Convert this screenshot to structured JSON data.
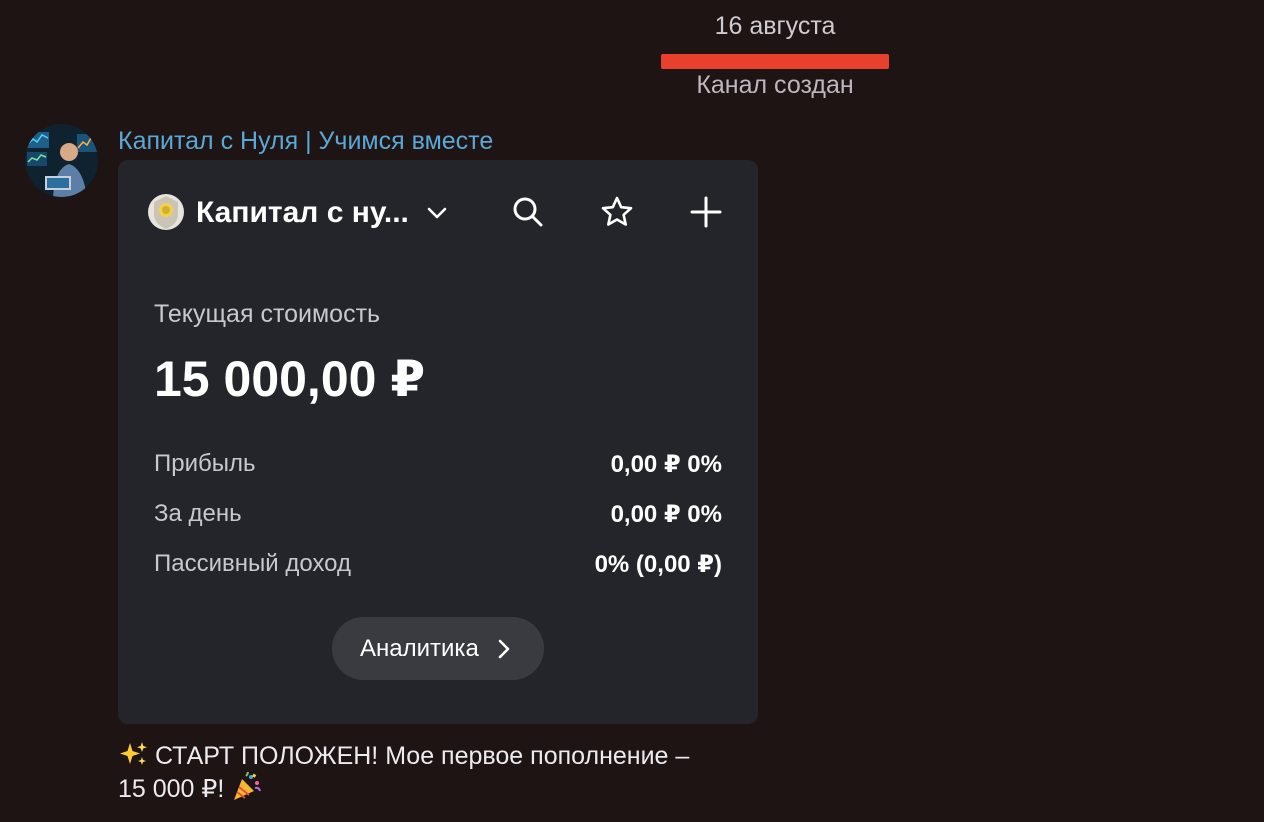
{
  "chat": {
    "date": "16 августа",
    "service_message": "Канал создан",
    "channel_name": "Капитал с Нуля | Учимся вместе"
  },
  "portfolio_card": {
    "portfolio_name": "Капитал с ну...",
    "current_value_label": "Текущая стоимость",
    "current_value": "15 000,00 ₽",
    "stats": [
      {
        "label": "Прибыль",
        "value": "0,00 ₽  0%"
      },
      {
        "label": "За день",
        "value": "0,00 ₽  0%"
      },
      {
        "label": "Пассивный доход",
        "value": "0% (0,00 ₽)"
      }
    ],
    "analytics_button": "Аналитика"
  },
  "message": {
    "text_line1": " СТАРТ ПОЛОЖЕН! Мое первое пополнение –",
    "text_line2": "15 000 ₽! "
  },
  "icons": [
    "avatar-photo",
    "bank-logo-icon",
    "chevron-down-icon",
    "search-icon",
    "star-icon",
    "plus-icon",
    "chevron-right-icon",
    "sparkles-icon",
    "party-popper-icon"
  ],
  "colors": {
    "background": "#1e1414",
    "card": "#24252a",
    "channel_name": "#5aa8d6",
    "highlight": "#e8402c",
    "button": "#3a3b40"
  }
}
